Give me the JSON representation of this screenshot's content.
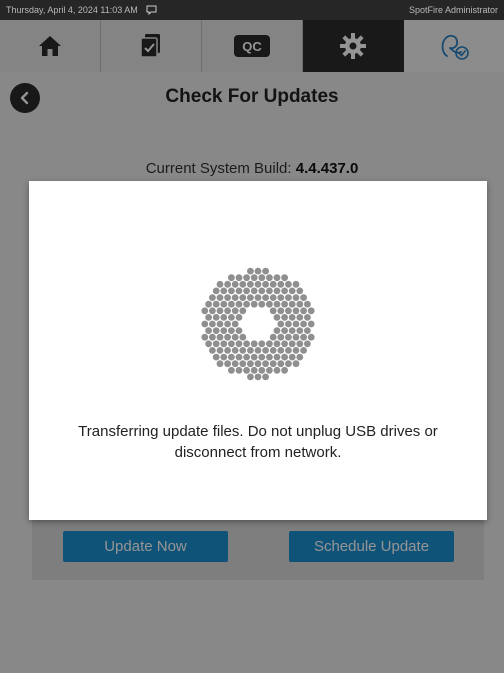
{
  "status_bar": {
    "datetime": "Thursday, April 4, 2024 11:03 AM",
    "user": "SpotFire Administrator"
  },
  "nav": {
    "items": [
      {
        "name": "home",
        "icon": "home-icon"
      },
      {
        "name": "checklist",
        "icon": "checkbox-icon"
      },
      {
        "name": "qc",
        "icon": "qc-icon",
        "label": "QC"
      },
      {
        "name": "settings",
        "icon": "gear-icon",
        "active": true
      },
      {
        "name": "user",
        "icon": "user-check-icon"
      }
    ]
  },
  "page": {
    "title": "Check For Updates",
    "build_label": "Current System Build:",
    "build_value": "4.4.437.0"
  },
  "buttons": {
    "update_now": "Update Now",
    "schedule_update": "Schedule Update"
  },
  "modal": {
    "message": "Transferring update files. Do not unplug USB drives or disconnect from network."
  },
  "colors": {
    "accent": "#1d8fd1",
    "nav_active": "#2b2b2b",
    "status_bar": "#262626"
  }
}
